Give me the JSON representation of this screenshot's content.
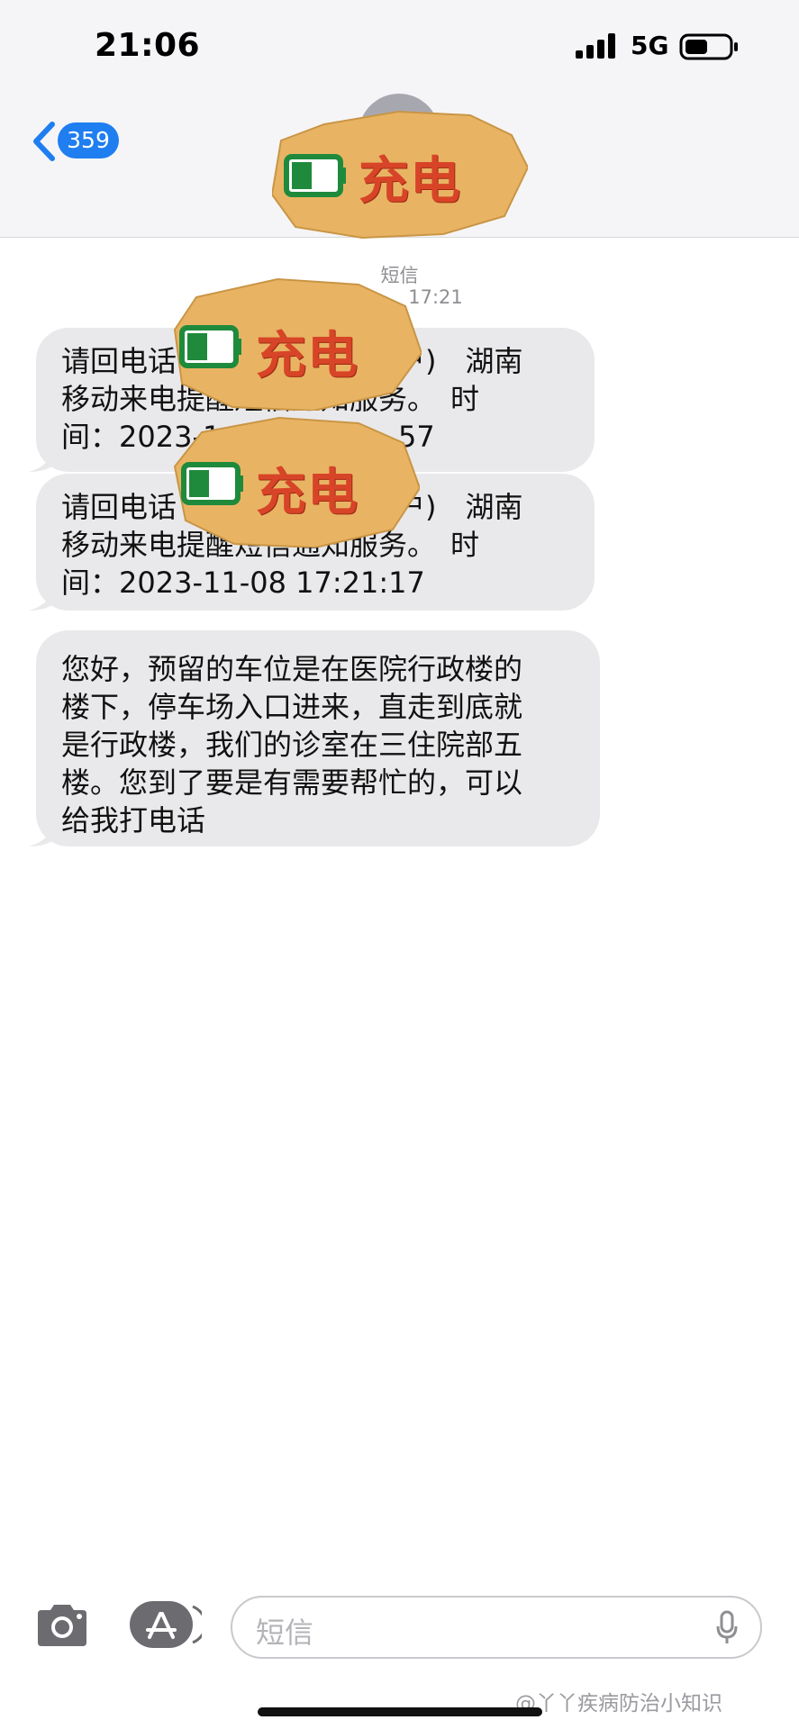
{
  "status_bar": {
    "time": "21:06",
    "network": "5G"
  },
  "nav": {
    "back_count": "359"
  },
  "stickers": [
    {
      "label": "充电",
      "icon": "battery-low-icon"
    },
    {
      "label": "充电",
      "icon": "battery-low-icon"
    },
    {
      "label": "充电",
      "icon": "battery-low-icon"
    }
  ],
  "conversation": {
    "service_label": "短信",
    "timestamp_visible": "17:21",
    "messages": [
      {
        "lines": [
          "请回电话",
          "用户)　湖南",
          "移动来电提醒短信通知服务。　时",
          "间：2023-1",
          "57"
        ]
      },
      {
        "lines": [
          "请回电话",
          "用户)　湖南",
          "移动来电提醒短信通知服务。　时",
          "间：2023-11-08 17:21:17"
        ]
      },
      {
        "lines": [
          "您好，预留的车位是在医院行政楼的",
          "楼下，停车场入口进来，直走到底就",
          "是行政楼，我们的诊室在三住院部五",
          "楼。您到了要是有需要帮忙的，可以",
          "给我打电话"
        ]
      }
    ]
  },
  "input_bar": {
    "placeholder": "短信"
  },
  "watermark": "@丫丫疾病防治小知识",
  "colors": {
    "accent": "#1f7ef0",
    "bubble_gray": "#e9e9eb",
    "sticker_paper": "#e8b464",
    "sticker_text": "#d84427",
    "battery_green": "#1f8a3c"
  }
}
